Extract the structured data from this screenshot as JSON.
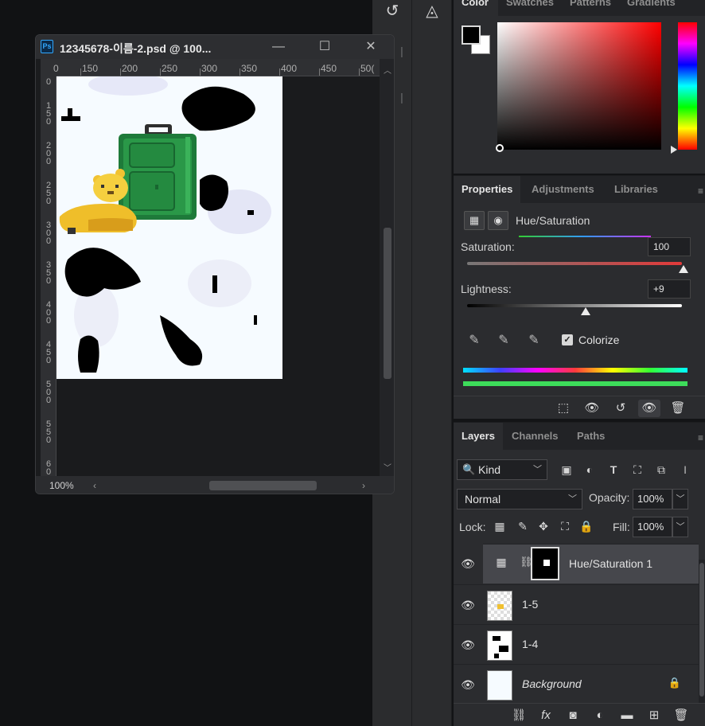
{
  "document": {
    "title": "12345678-이름-2.psd @ 100...",
    "zoom": "100%",
    "ruler_top": [
      "0",
      "150",
      "200",
      "250",
      "300",
      "350",
      "400",
      "450",
      "50("
    ],
    "ruler_left": [
      "0",
      "150",
      "200",
      "250",
      "300",
      "350",
      "400",
      "450",
      "500",
      "550",
      "60"
    ]
  },
  "color_panel": {
    "tabs": [
      "Color",
      "Swatches",
      "Patterns",
      "Gradients"
    ],
    "foreground": "#000000",
    "background": "#ffffff"
  },
  "properties_panel": {
    "tabs": [
      "Properties",
      "Adjustments",
      "Libraries"
    ],
    "adjustment_title": "Hue/Saturation",
    "saturation_label": "Saturation:",
    "saturation_value": "100",
    "lightness_label": "Lightness:",
    "lightness_value": "+9",
    "colorize_label": "Colorize",
    "colorize_checked": true
  },
  "layers_panel": {
    "tabs": [
      "Layers",
      "Channels",
      "Paths"
    ],
    "kind_label": "Kind",
    "blend_mode": "Normal",
    "opacity_label": "Opacity:",
    "opacity_value": "100%",
    "lock_label": "Lock:",
    "fill_label": "Fill:",
    "fill_value": "100%",
    "layers": [
      {
        "name": "Hue/Saturation 1",
        "selected": true
      },
      {
        "name": "1-5"
      },
      {
        "name": "1-4"
      },
      {
        "name": "Background",
        "locked": true
      }
    ]
  },
  "colors": {
    "accent": "#31a8ff",
    "panel_bg": "#2b2c2f",
    "canvas_bg": "#f6fbff"
  }
}
